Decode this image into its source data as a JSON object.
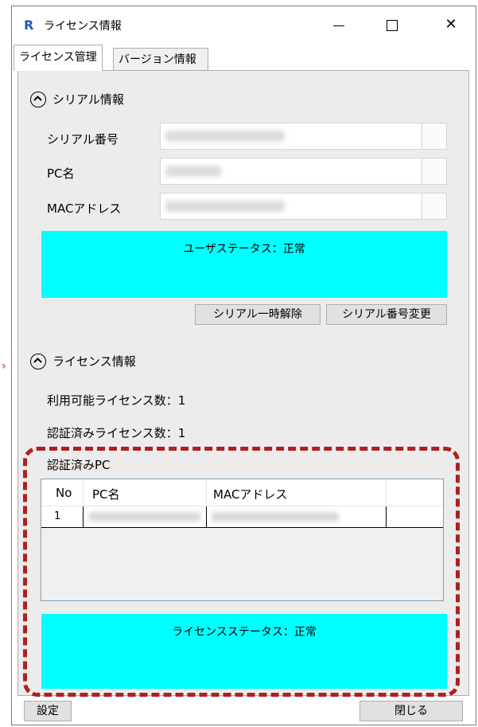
{
  "window": {
    "title": "ライセンス情報",
    "app_icon": "R",
    "controls": {
      "minimize": "—",
      "maximize": "☐",
      "close": "✕"
    }
  },
  "tabs": [
    {
      "label": "ライセンス管理",
      "active": true
    },
    {
      "label": "バージョン情報",
      "active": false
    }
  ],
  "serial_section": {
    "heading": "シリアル情報",
    "fields": [
      {
        "label": "シリアル番号",
        "value": ""
      },
      {
        "label": "PC名",
        "value": ""
      },
      {
        "label": "MACアドレス",
        "value": ""
      }
    ],
    "user_status": "ユーザステータス：正常",
    "buttons": {
      "temp_release": "シリアル一時解除",
      "change_serial": "シリアル番号変更"
    }
  },
  "license_section": {
    "heading": "ライセンス情報",
    "available_count": "利用可能ライセンス数：1",
    "authenticated_count": "認証済みライセンス数：1",
    "authenticated_pc_label": "認証済みPC",
    "table": {
      "columns": [
        "No",
        "PC名",
        "MACアドレス"
      ],
      "rows": [
        {
          "no": "1",
          "pc_name": "",
          "mac": ""
        }
      ]
    },
    "license_status": "ライセンスステータス：正常"
  },
  "footer": {
    "settings": "設定",
    "close": "閉じる"
  },
  "colors": {
    "status_bg": "#00ffff",
    "highlight": "#b01f1f",
    "panel_bg": "#ececec"
  },
  "icons": [
    "app-logo-icon",
    "collapse-chevron-icon",
    "minimize-icon",
    "maximize-icon",
    "close-icon"
  ]
}
